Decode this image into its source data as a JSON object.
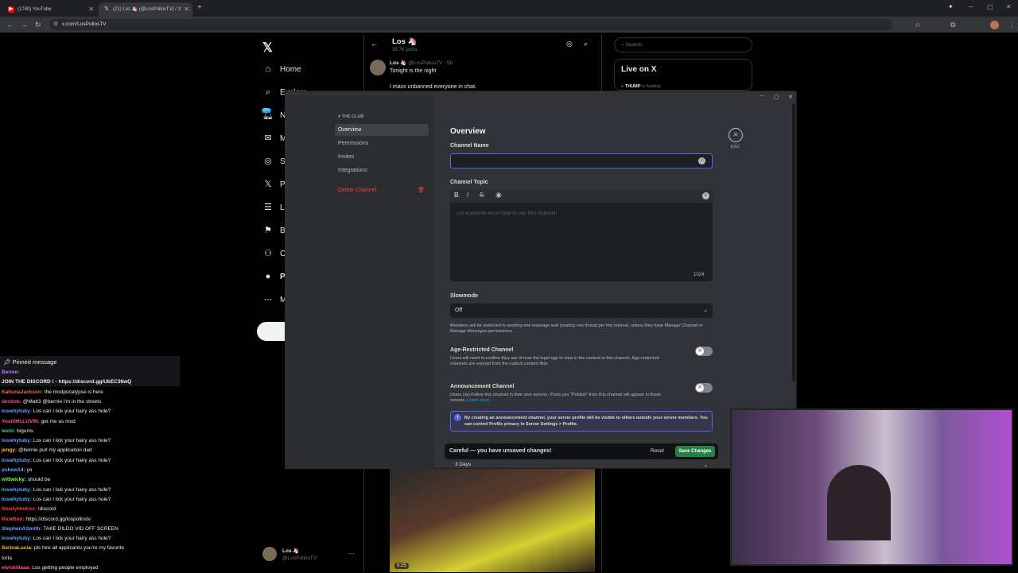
{
  "browser": {
    "tabs": [
      {
        "title": "(1740) YouTube",
        "icon": "youtube-icon",
        "color": "#ff0000"
      },
      {
        "title": "(21) Los 🦄 (@LosPollosTV) / X",
        "icon": "x-icon",
        "color": "#ffffff"
      }
    ],
    "url": "x.com/LosPollosTV"
  },
  "x_sidebar": {
    "items": [
      {
        "label": "Home",
        "icon": "home-icon"
      },
      {
        "label": "Explore",
        "icon": "search-icon"
      },
      {
        "label": "N",
        "icon": "bell-icon",
        "badge": "20+"
      },
      {
        "label": "M",
        "icon": "mail-icon"
      },
      {
        "label": "S",
        "icon": "grok-icon"
      },
      {
        "label": "P",
        "icon": "x-premium-icon"
      },
      {
        "label": "L",
        "icon": "list-icon"
      },
      {
        "label": "B",
        "icon": "bookmark-icon"
      },
      {
        "label": "C",
        "icon": "communities-icon"
      },
      {
        "label": "P",
        "icon": "profile-icon"
      },
      {
        "label": "M",
        "icon": "more-icon"
      }
    ],
    "account_name": "Los 🦄",
    "account_handle": "@LosPollosTV"
  },
  "x_profile": {
    "name": "Los 🦄",
    "posts": "39.7K posts",
    "tweet_name": "Los 🦄",
    "tweet_handle": "@LosPollosTV · 5h",
    "tweet_line1": "Tonight is the night",
    "tweet_line2": "I mass unbanned everyone in chat.",
    "video_time": "0:25"
  },
  "x_right": {
    "search_placeholder": "Search",
    "live_title": "Live on X",
    "live_user": "THUMP",
    "live_status": "is hosting"
  },
  "discord": {
    "server_name": "THE CLUB",
    "menu": [
      "Overview",
      "Permissions",
      "Invites",
      "Integrations"
    ],
    "delete_label": "Delete Channel",
    "heading": "Overview",
    "esc_label": "ESC",
    "channel_name_label": "Channel Name",
    "channel_name_value": "",
    "channel_topic_label": "Channel Topic",
    "topic_placeholder": "Let everyone know how to use this channel!",
    "topic_counter": "1024",
    "slowmode_label": "Slowmode",
    "slowmode_value": "Off",
    "slowmode_help": "Members will be restricted to sending one message and creating one thread per this interval, unless they have Manage Channel or Manage Messages permissions.",
    "age_label": "Age-Restricted Channel",
    "age_help": "Users will need to confirm they are of over the legal age to view in the content in this channel. Age-restricted channels are exempt from the explicit content filter.",
    "announce_label": "Announcement Channel",
    "announce_help": "Users can Follow this channel in their own servers. Posts you \"Publish\" from this channel will appear in those servers.",
    "learn_more": "Learn more.",
    "info_text": "By creating an announcement channel, your server profile will be visible to others outside your server members. You can control Profile privacy in Server Settings > Profile.",
    "hidden_select_value": "3 Days",
    "unsaved_text": "Careful — you have unsaved changes!",
    "reset_label": "Reset",
    "save_label": "Save Changes",
    "accent": "#5865f2",
    "save_color": "#248046",
    "danger": "#f23f43"
  },
  "chat": {
    "pinned_label": "Pinned message",
    "messages": [
      {
        "user": "Bernie:",
        "color": "#b07cff",
        "text": ""
      },
      {
        "user": "",
        "color": "#ffffff",
        "text": "JOIN THE DISCORD ! - https://discord.gg/UbEC36wQ"
      },
      {
        "user": "KahunaJackson:",
        "color": "#ff6a3d",
        "text": "the modpocalypse is here"
      },
      {
        "user": "devinm:",
        "color": "#ff4f9a",
        "text": "@Matt3 @bernie I'm in the streets"
      },
      {
        "user": "loswhytuby:",
        "color": "#6aa0ff",
        "text": "Los can I lick your hairy ass hole?"
      },
      {
        "user": "YoshiMcLUVIN:",
        "color": "#ff4f9a",
        "text": "get me as mod"
      },
      {
        "user": "lesto:",
        "color": "#3fd1a0",
        "text": "bigums"
      },
      {
        "user": "loswhytuby:",
        "color": "#6aa0ff",
        "text": "Los can I lick your hairy ass hole?"
      },
      {
        "user": "jengy:",
        "color": "#ffbf3d",
        "text": "@bernie pull my application dad"
      },
      {
        "user": "loswhytuby:",
        "color": "#6aa0ff",
        "text": "Los can I lick your hairy ass hole?"
      },
      {
        "user": "pshew14:",
        "color": "#6aa0ff",
        "text": "yo"
      },
      {
        "user": "wittwicky:",
        "color": "#7bff5a",
        "text": "should be"
      },
      {
        "user": "loswhytuby:",
        "color": "#6aa0ff",
        "text": "Los can I lick your hairy ass hole?"
      },
      {
        "user": "loswhytuby:",
        "color": "#6aa0ff",
        "text": "Los can I lick your hairy ass hole?"
      },
      {
        "user": "ShadyHndrxx:",
        "color": "#ff3d3d",
        "text": "!discord"
      },
      {
        "user": "RickRoo:",
        "color": "#ff4f4f",
        "text": "https://discord.gg/lospollostv"
      },
      {
        "user": "StephenASmith:",
        "color": "#6aa0ff",
        "text": "TAKE DILDO VID OFF SCREEN"
      },
      {
        "user": "loswhytuby:",
        "color": "#6aa0ff",
        "text": "Los can I lick your hairy ass hole?"
      },
      {
        "user": "SerinaLucia:",
        "color": "#ffbf3d",
        "text": "pls hire all applicants,you're my favorite"
      },
      {
        "user": "",
        "color": "#ffffff",
        "text": "torta"
      },
      {
        "user": "elviskillaaa:",
        "color": "#ff4f9a",
        "text": "Los getting people employed"
      }
    ]
  }
}
